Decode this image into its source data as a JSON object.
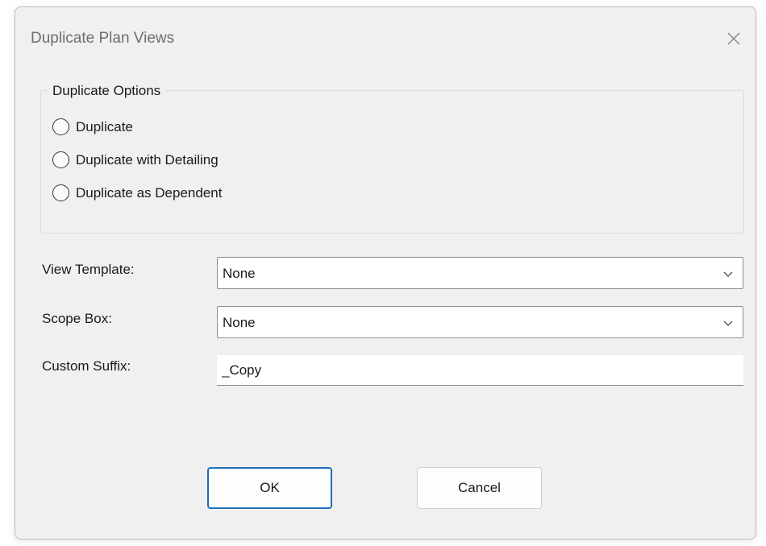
{
  "dialog": {
    "title": "Duplicate Plan Views"
  },
  "options_group": {
    "legend": "Duplicate Options",
    "radios": [
      {
        "label": "Duplicate",
        "checked": false
      },
      {
        "label": "Duplicate with Detailing",
        "checked": false
      },
      {
        "label": "Duplicate as Dependent",
        "checked": false
      }
    ]
  },
  "fields": {
    "view_template": {
      "label": "View Template:",
      "value": "None"
    },
    "scope_box": {
      "label": "Scope Box:",
      "value": "None"
    },
    "custom_suffix": {
      "label": "Custom Suffix:",
      "value": "_Copy"
    }
  },
  "buttons": {
    "ok_label": "OK",
    "cancel_label": "Cancel"
  },
  "icons": {
    "close": "close-icon",
    "dropdown": "chevron-down-icon"
  },
  "colors": {
    "dialog_background": "#f0f0f0",
    "focus_accent": "#1f6fb8",
    "title_text": "#6e6e6e"
  }
}
